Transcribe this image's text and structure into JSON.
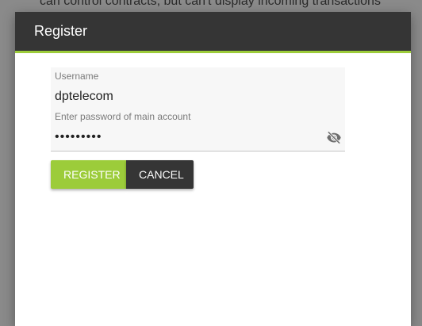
{
  "background": {
    "text": "can control contracts, but can't display incoming transactions"
  },
  "dialog": {
    "title": "Register",
    "username": {
      "label": "Username",
      "value": "dptelecom"
    },
    "password": {
      "label": "Enter password of main account",
      "value": "•••••••••",
      "toggle_icon": "visibility-off-icon"
    },
    "buttons": {
      "register": "REGISTER",
      "cancel": "CANCEL"
    }
  },
  "colors": {
    "accent": "#9ccc3a",
    "header": "#353535"
  }
}
